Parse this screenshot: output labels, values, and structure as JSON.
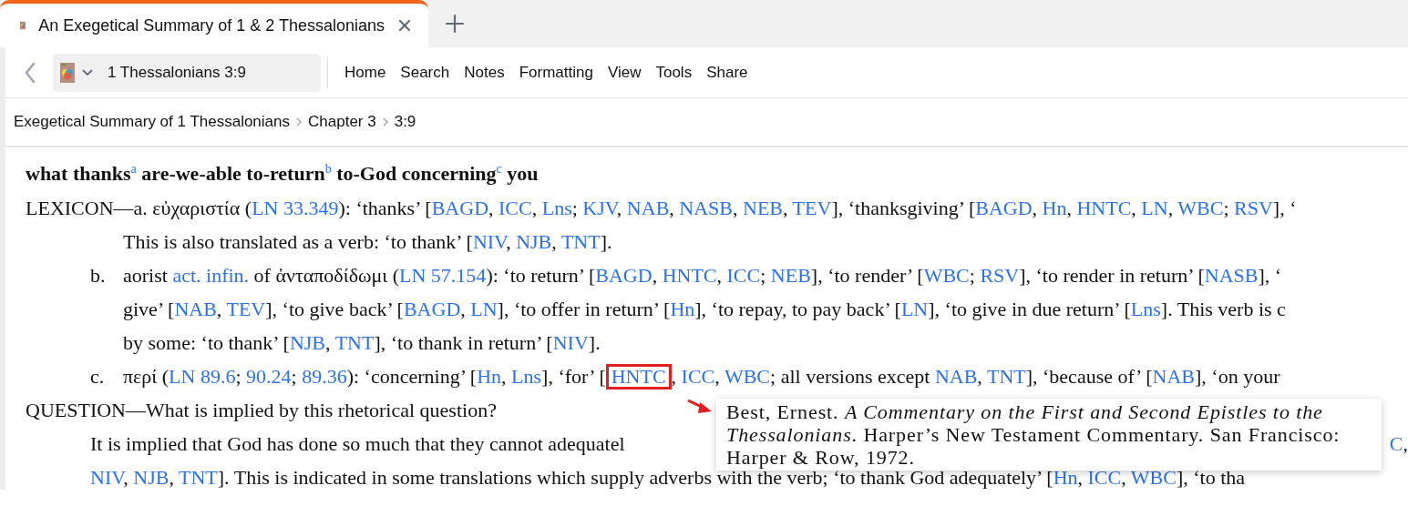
{
  "tab": {
    "title": "An Exegetical Summary of 1 & 2 Thessalonians",
    "selected": true
  },
  "toolbar": {
    "resource": "1 Thessalonians 3:9",
    "menu": [
      "Home",
      "Search",
      "Notes",
      "Formatting",
      "View",
      "Tools",
      "Share"
    ]
  },
  "breadcrumb": [
    "Exegetical Summary of 1 Thessalonians",
    "Chapter 3",
    "3:9"
  ],
  "heading": "what thanks$^{a}$ are-we-able to-return$^{b}$ to-God concerning$^{c}$ you",
  "paragraphs": [
    {
      "kind": "entry",
      "lines": [
        [
          "LEXICON—a. εὐχαριστία (",
          {
            "kind": "link",
            "text": "LN 33.349"
          },
          "): ‘thanks’ [",
          {
            "kind": "link",
            "text": "BAGD"
          },
          ", ",
          {
            "kind": "link",
            "text": "ICC"
          },
          ", ",
          {
            "kind": "link",
            "text": "Lns"
          },
          "; ",
          {
            "kind": "link",
            "text": "KJV"
          },
          ", ",
          {
            "kind": "link",
            "text": "NAB"
          },
          ", ",
          {
            "kind": "link",
            "text": "NASB"
          },
          ", ",
          {
            "kind": "link",
            "text": "NEB"
          },
          ", ",
          {
            "kind": "link",
            "text": "TEV"
          },
          "], ‘thanksgiving’ [",
          {
            "kind": "link",
            "text": "BAGD"
          },
          ", ",
          {
            "kind": "link",
            "text": "Hn"
          },
          ", ",
          {
            "kind": "link",
            "text": "HNTC"
          },
          ", ",
          {
            "kind": "link",
            "text": "LN"
          },
          ", ",
          {
            "kind": "link",
            "text": "WBC"
          },
          "; ",
          {
            "kind": "link",
            "text": "RSV"
          },
          "], ‘"
        ],
        [
          "This is also translated as a verb: ‘to thank’ [",
          {
            "kind": "link",
            "text": "NIV"
          },
          ", ",
          {
            "kind": "link",
            "text": "NJB"
          },
          ", ",
          {
            "kind": "link",
            "text": "TNT"
          },
          "]."
        ]
      ]
    },
    {
      "kind": "sub",
      "label": "b.",
      "lines": [
        [
          "aorist ",
          {
            "kind": "link",
            "text": "act. infin."
          },
          " of ἀνταποδίδωμι (",
          {
            "kind": "link",
            "text": "LN 57.154"
          },
          "): ‘to return’ [",
          {
            "kind": "link",
            "text": "BAGD"
          },
          ", ",
          {
            "kind": "link",
            "text": "HNTC"
          },
          ", ",
          {
            "kind": "link",
            "text": "ICC"
          },
          "; ",
          {
            "kind": "link",
            "text": "NEB"
          },
          "], ‘to render’ [",
          {
            "kind": "link",
            "text": "WBC"
          },
          "; ",
          {
            "kind": "link",
            "text": "RSV"
          },
          "], ‘to render in return’ [",
          {
            "kind": "link",
            "text": "NASB"
          },
          "], ‘"
        ],
        [
          "give’ [",
          {
            "kind": "link",
            "text": "NAB"
          },
          ", ",
          {
            "kind": "link",
            "text": "TEV"
          },
          "], ‘to give back’ [",
          {
            "kind": "link",
            "text": "BAGD"
          },
          ", ",
          {
            "kind": "link",
            "text": "LN"
          },
          "], ‘to offer in return’ [",
          {
            "kind": "link",
            "text": "Hn"
          },
          "], ‘to repay, to pay back’ [",
          {
            "kind": "link",
            "text": "LN"
          },
          "], ‘to give in due return’ [",
          {
            "kind": "link",
            "text": "Lns"
          },
          "]. This verb is c"
        ],
        [
          "by some: ‘to thank’ [",
          {
            "kind": "link",
            "text": "NJB"
          },
          ", ",
          {
            "kind": "link",
            "text": "TNT"
          },
          "], ‘to thank in return’ [",
          {
            "kind": "link",
            "text": "NIV"
          },
          "]."
        ]
      ]
    },
    {
      "kind": "sub",
      "label": "c.",
      "lines": [
        [
          "περί (",
          {
            "kind": "link",
            "text": "LN 89.6"
          },
          "; ",
          {
            "kind": "link",
            "text": "90.24"
          },
          "; ",
          {
            "kind": "link",
            "text": "89.36"
          },
          "): ‘concerning’ [",
          {
            "kind": "link",
            "text": "Hn"
          },
          ", ",
          {
            "kind": "link",
            "text": "Lns"
          },
          "], ‘for’ [",
          {
            "kind": "link",
            "text": "HNTC",
            "highlighted": true
          },
          ", ",
          {
            "kind": "link",
            "text": "ICC"
          },
          ", ",
          {
            "kind": "link",
            "text": "WBC"
          },
          "; all versions except ",
          {
            "kind": "link",
            "text": "NAB"
          },
          ", ",
          {
            "kind": "link",
            "text": "TNT"
          },
          "], ‘because of’ [",
          {
            "kind": "link",
            "text": "NAB"
          },
          "], ‘on your"
        ]
      ]
    },
    {
      "kind": "entry",
      "lines": [
        [
          "QUESTION—What is implied by this rhetorical question?"
        ]
      ]
    },
    {
      "kind": "answer",
      "lines": [
        [
          "It is implied that God has done so much that they cannot adequatel",
          {
            "kind": "gap"
          },
          {
            "kind": "link",
            "text": "C"
          },
          ","
        ],
        [
          {
            "kind": "link",
            "text": "NIV"
          },
          ", ",
          {
            "kind": "link",
            "text": "NJB"
          },
          ", ",
          {
            "kind": "link",
            "text": "TNT"
          },
          "]. This is indicated in some translations which supply adverbs with the verb; ‘to thank God adequately’ [",
          {
            "kind": "link",
            "text": "Hn"
          },
          ", ",
          {
            "kind": "link",
            "text": "ICC"
          },
          ", ",
          {
            "kind": "link",
            "text": "WBC"
          },
          "], ‘to tha"
        ]
      ]
    }
  ],
  "tooltip": {
    "text": "Best, Ernest. *A Commentary on the First and Second Epistles to the Thessalonians*. Harper’s New Testament Commentary. San Francisco: Harper & Row, 1972."
  }
}
